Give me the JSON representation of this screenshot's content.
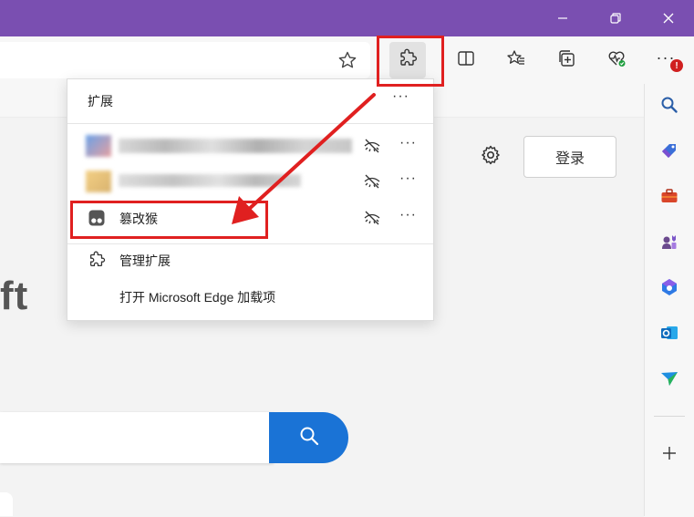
{
  "window": {
    "minimize_icon": "minimize-icon",
    "restore_icon": "restore-icon",
    "close_icon": "close-icon",
    "accent_color": "#7a4fb1"
  },
  "toolbar": {
    "favorite_star_icon": "star-icon",
    "extensions_icon": "puzzle-icon",
    "split_screen_icon": "split-screen-icon",
    "favorites_icon": "favorites-icon",
    "collections_icon": "collections-icon",
    "browser_essentials_icon": "heart-pulse-icon",
    "more_icon": "more-icon",
    "notification_badge": "!"
  },
  "extensions_menu": {
    "title": "扩展",
    "more": "···",
    "items": [
      {
        "label": "",
        "blurred": true,
        "icon": "extension-icon",
        "hide_icon": "eye-hidden-icon",
        "more": "···"
      },
      {
        "label": "",
        "blurred": true,
        "icon": "extension-icon",
        "hide_icon": "eye-hidden-icon",
        "more": "···"
      },
      {
        "label": "篡改猴",
        "icon": "tampermonkey-icon",
        "hide_icon": "eye-hidden-icon",
        "more": "···"
      }
    ],
    "manage": "管理扩展",
    "open_addons": "打开 Microsoft Edge 加载项"
  },
  "page": {
    "brand_partial": "ft",
    "login_button": "登录",
    "settings_icon": "gear-icon",
    "search_icon": "search-icon",
    "search_button_color": "#1a73d6"
  },
  "sidebar": {
    "items": [
      "search-icon",
      "tag-icon",
      "toolbox-icon",
      "games-icon",
      "copilot-icon",
      "outlook-icon",
      "send-icon"
    ],
    "add_icon": "plus-icon"
  },
  "annotation_color": "#e02020"
}
